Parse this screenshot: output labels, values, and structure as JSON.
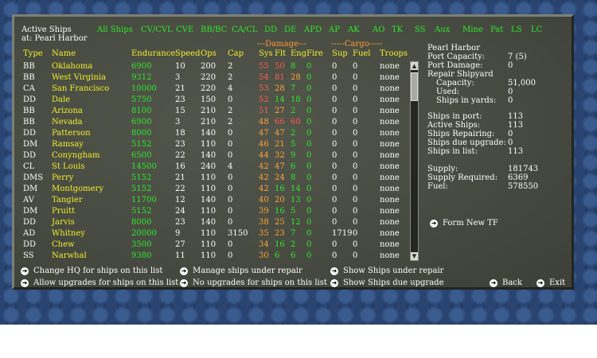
{
  "title_line1": "Active Ships",
  "title_line2": "at: Pearl Harbor",
  "filters": [
    "All Ships",
    "CV/CVL",
    "CVE",
    "BB/BC",
    "CA/CL",
    "DD",
    "DE",
    "APD",
    "AP",
    "AK",
    "AO",
    "TK",
    "SS",
    "Aux",
    "Mine",
    "Pat",
    "LS",
    "LC"
  ],
  "group_headers": {
    "damage": "Damage",
    "cargo": "Cargo"
  },
  "headers": {
    "type": "Type",
    "name": "Name",
    "endurance": "Endurance",
    "speed": "Speed",
    "ops": "Ops",
    "cap": "Cap",
    "sys": "Sys",
    "flt": "Flt",
    "eng": "Eng",
    "fire": "Fire",
    "sup": "Sup",
    "fuel": "Fuel",
    "troops": "Troops"
  },
  "ships": [
    {
      "type": "BB",
      "name": "Oklahoma",
      "endurance": "6900",
      "speed": "10",
      "ops": "200",
      "cap": "2",
      "sys": "55",
      "flt": "50",
      "eng": "8",
      "fire": "0",
      "sup": "0",
      "fuel": "0",
      "troops": "none"
    },
    {
      "type": "BB",
      "name": "West Virginia",
      "endurance": "9312",
      "speed": "3",
      "ops": "220",
      "cap": "2",
      "sys": "54",
      "flt": "81",
      "eng": "28",
      "fire": "0",
      "sup": "0",
      "fuel": "0",
      "troops": "none"
    },
    {
      "type": "CA",
      "name": "San Francisco",
      "endurance": "10000",
      "speed": "21",
      "ops": "220",
      "cap": "4",
      "sys": "53",
      "flt": "28",
      "eng": "7",
      "fire": "0",
      "sup": "0",
      "fuel": "0",
      "troops": "none"
    },
    {
      "type": "DD",
      "name": "Dale",
      "endurance": "5750",
      "speed": "23",
      "ops": "150",
      "cap": "0",
      "sys": "52",
      "flt": "14",
      "eng": "18",
      "fire": "0",
      "sup": "0",
      "fuel": "0",
      "troops": "none"
    },
    {
      "type": "BB",
      "name": "Arizona",
      "endurance": "8100",
      "speed": "15",
      "ops": "210",
      "cap": "2",
      "sys": "51",
      "flt": "27",
      "eng": "2",
      "fire": "0",
      "sup": "0",
      "fuel": "0",
      "troops": "none"
    },
    {
      "type": "BB",
      "name": "Nevada",
      "endurance": "6900",
      "speed": "3",
      "ops": "210",
      "cap": "2",
      "sys": "48",
      "flt": "66",
      "eng": "60",
      "fire": "0",
      "sup": "0",
      "fuel": "0",
      "troops": "none"
    },
    {
      "type": "DD",
      "name": "Patterson",
      "endurance": "8000",
      "speed": "18",
      "ops": "140",
      "cap": "0",
      "sys": "47",
      "flt": "47",
      "eng": "2",
      "fire": "0",
      "sup": "0",
      "fuel": "0",
      "troops": "none"
    },
    {
      "type": "DM",
      "name": "Ramsay",
      "endurance": "5152",
      "speed": "23",
      "ops": "110",
      "cap": "0",
      "sys": "46",
      "flt": "21",
      "eng": "5",
      "fire": "0",
      "sup": "0",
      "fuel": "0",
      "troops": "none"
    },
    {
      "type": "DD",
      "name": "Conyngham",
      "endurance": "6500",
      "speed": "22",
      "ops": "140",
      "cap": "0",
      "sys": "44",
      "flt": "32",
      "eng": "9",
      "fire": "0",
      "sup": "0",
      "fuel": "0",
      "troops": "none"
    },
    {
      "type": "CL",
      "name": "St Louis",
      "endurance": "14500",
      "speed": "16",
      "ops": "240",
      "cap": "4",
      "sys": "42",
      "flt": "47",
      "eng": "6",
      "fire": "0",
      "sup": "0",
      "fuel": "0",
      "troops": "none"
    },
    {
      "type": "DMS",
      "name": "Perry",
      "endurance": "5152",
      "speed": "21",
      "ops": "110",
      "cap": "0",
      "sys": "42",
      "flt": "24",
      "eng": "8",
      "fire": "0",
      "sup": "0",
      "fuel": "0",
      "troops": "none"
    },
    {
      "type": "DM",
      "name": "Montgomery",
      "endurance": "5152",
      "speed": "22",
      "ops": "110",
      "cap": "0",
      "sys": "42",
      "flt": "16",
      "eng": "14",
      "fire": "0",
      "sup": "0",
      "fuel": "0",
      "troops": "none"
    },
    {
      "type": "AV",
      "name": "Tangier",
      "endurance": "11700",
      "speed": "12",
      "ops": "140",
      "cap": "0",
      "sys": "40",
      "flt": "20",
      "eng": "13",
      "fire": "0",
      "sup": "0",
      "fuel": "0",
      "troops": "none"
    },
    {
      "type": "DM",
      "name": "Pruitt",
      "endurance": "5152",
      "speed": "24",
      "ops": "110",
      "cap": "0",
      "sys": "39",
      "flt": "16",
      "eng": "5",
      "fire": "0",
      "sup": "0",
      "fuel": "0",
      "troops": "none"
    },
    {
      "type": "DD",
      "name": "Jarvis",
      "endurance": "8000",
      "speed": "23",
      "ops": "140",
      "cap": "0",
      "sys": "38",
      "flt": "25",
      "eng": "12",
      "fire": "0",
      "sup": "0",
      "fuel": "0",
      "troops": "none"
    },
    {
      "type": "AD",
      "name": "Whitney",
      "endurance": "20000",
      "speed": "9",
      "ops": "110",
      "cap": "3150",
      "sys": "35",
      "flt": "23",
      "eng": "7",
      "fire": "0",
      "sup": "1719",
      "fuel": "0",
      "troops": "none"
    },
    {
      "type": "DD",
      "name": "Chew",
      "endurance": "3500",
      "speed": "27",
      "ops": "110",
      "cap": "0",
      "sys": "34",
      "flt": "16",
      "eng": "2",
      "fire": "0",
      "sup": "0",
      "fuel": "0",
      "troops": "none"
    },
    {
      "type": "SS",
      "name": "Narwhal",
      "endurance": "9380",
      "speed": "11",
      "ops": "110",
      "cap": "0",
      "sys": "30",
      "flt": "6",
      "eng": "6",
      "fire": "0",
      "sup": "0",
      "fuel": "0",
      "troops": "none"
    }
  ],
  "side": {
    "location": "Pearl Harbor",
    "port_capacity_label": "Port Capacity:",
    "port_capacity": "7 (5)",
    "port_damage_label": "Port Damage:",
    "port_damage": "0",
    "repair_shipyard_label": "Repair Shipyard",
    "capacity_label": "Capacity:",
    "capacity": "51,000",
    "used_label": "Used:",
    "used": "0",
    "in_yards_label": "Ships in yards:",
    "in_yards": "0",
    "in_port_label": "Ships in port:",
    "in_port": "113",
    "active_label": "Active Ships:",
    "active": "113",
    "repairing_label": "Ships Repairing:",
    "repairing": "0",
    "due_upgrade_label": "Ships due upgrade:",
    "due_upgrade": "0",
    "in_list_label": "Ships in list:",
    "in_list": "113",
    "supply_label": "Supply:",
    "supply": "181743",
    "supply_req_label": "Supply Required:",
    "supply_req": "6369",
    "fuel_label": "Fuel:",
    "fuel": "578550",
    "form_tf": "Form New TF"
  },
  "buttons": {
    "change_hq": "Change HQ for ships on this list",
    "allow_upgrades": "Allow upgrades for ships on this list",
    "manage_repair": "Manage ships under repair",
    "no_upgrades": "No upgrades for ships on this list",
    "show_repair": "Show Ships under repair",
    "show_upgrade": "Show Ships due upgrade",
    "back": "Back",
    "exit": "Exit"
  },
  "colors": {
    "panel": "#474a40",
    "text": "#ffffff",
    "name_yellow": "#f1ef2c",
    "green": "#2ee82c",
    "red": "#ff5b4d",
    "orange": "#ffa33a"
  }
}
